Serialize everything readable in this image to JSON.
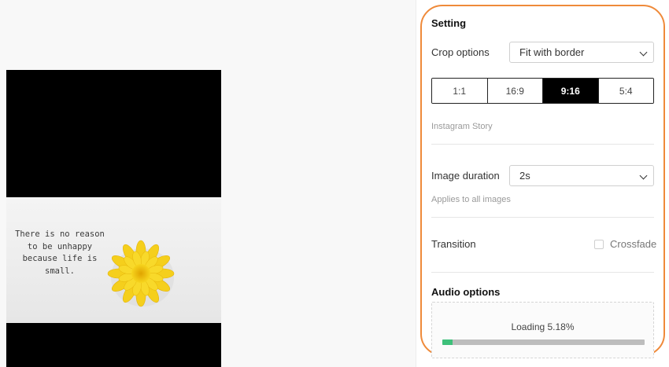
{
  "preview": {
    "quote_text": "There is no reason\nto be unhappy\nbecause life is\nsmall."
  },
  "settings": {
    "title": "Setting",
    "crop_options": {
      "label": "Crop options",
      "selected": "Fit with border"
    },
    "aspect_ratios": [
      {
        "label": "1:1",
        "active": false
      },
      {
        "label": "16:9",
        "active": false
      },
      {
        "label": "9:16",
        "active": true
      },
      {
        "label": "5:4",
        "active": false
      }
    ],
    "preset_hint": "Instagram Story",
    "image_duration": {
      "label": "Image duration",
      "selected": "2s",
      "hint": "Applies to all images"
    },
    "transition": {
      "label": "Transition",
      "option_label": "Crossfade",
      "checked": false
    }
  },
  "audio": {
    "title": "Audio options",
    "loading_text": "Loading 5.18%",
    "progress": 0.0518
  },
  "colors": {
    "highlight_outline": "#ef8a3a",
    "progress_fill": "#3ec07a",
    "active_ratio_bg": "#000000"
  }
}
